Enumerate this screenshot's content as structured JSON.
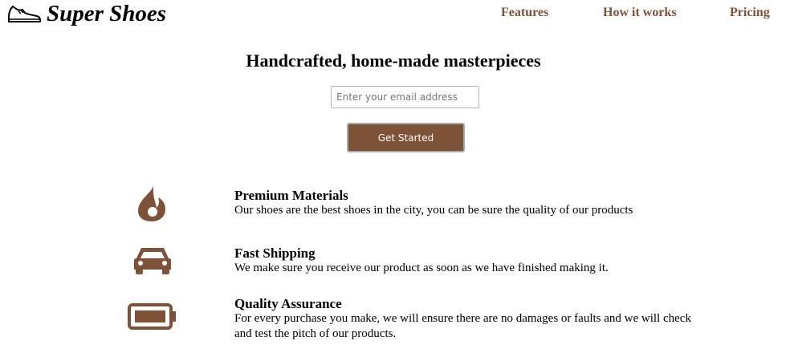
{
  "header": {
    "brand": "Super Shoes",
    "logo_icon": "sneaker-icon",
    "nav": [
      {
        "label": "Features"
      },
      {
        "label": "How it works"
      },
      {
        "label": "Pricing"
      }
    ]
  },
  "hero": {
    "title": "Handcrafted, home-made masterpieces",
    "email_placeholder": "Enter your email address",
    "email_value": "",
    "cta_label": "Get Started"
  },
  "features": [
    {
      "icon": "fire-icon",
      "title": "Premium Materials",
      "description": "Our shoes are the best shoes in the city, you can be sure the quality of our products"
    },
    {
      "icon": "car-icon",
      "title": "Fast Shipping",
      "description": "We make sure you receive our product as soon as we have finished making it."
    },
    {
      "icon": "battery-icon",
      "title": "Quality Assurance",
      "description": "For every purchase you make, we will ensure there are no damages or faults and we will check and test the pitch of our products."
    }
  ],
  "colors": {
    "accent": "#7d5236",
    "button_border": "#a9a9a9",
    "text": "#000000"
  }
}
